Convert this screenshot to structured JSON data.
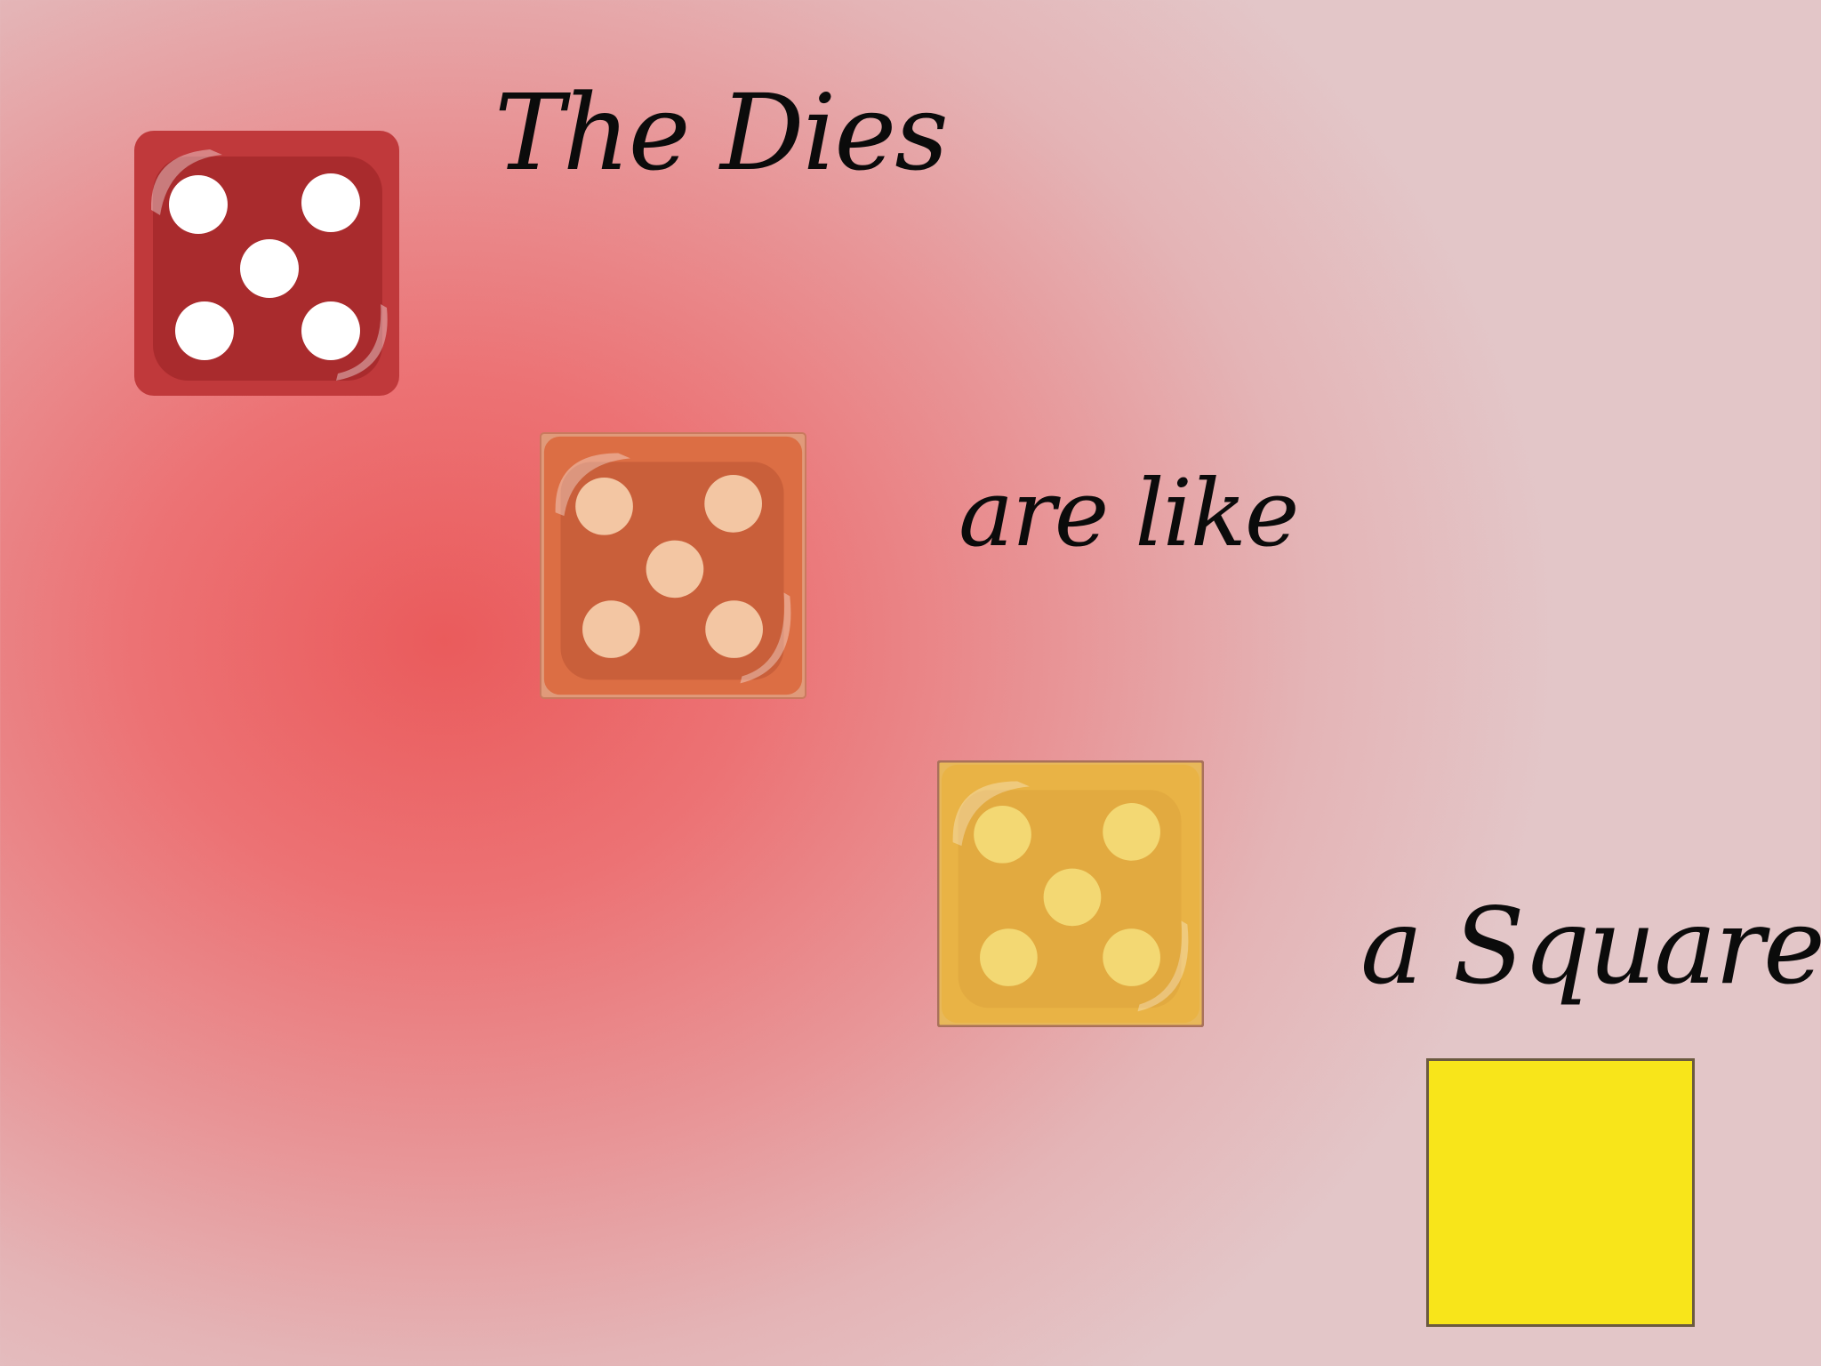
{
  "captions": {
    "line1": "The Dies",
    "line2": "are  like",
    "line3": "a Square"
  },
  "dice": [
    {
      "face": 5,
      "body": "#c0393b",
      "inner": "#a92b2d",
      "pip": "#ffffff",
      "frame": "#c0393b"
    },
    {
      "face": 5,
      "body": "#dc6e44",
      "inner": "#c95f3a",
      "pip": "#f3c6a3",
      "frame": "#c97a5e"
    },
    {
      "face": 5,
      "body": "#e9b345",
      "inner": "#e2aa40",
      "pip": "#f3d873",
      "frame": "#a9715a"
    }
  ],
  "square": {
    "fill": "#f8e51a",
    "border": "#6b5a40"
  }
}
